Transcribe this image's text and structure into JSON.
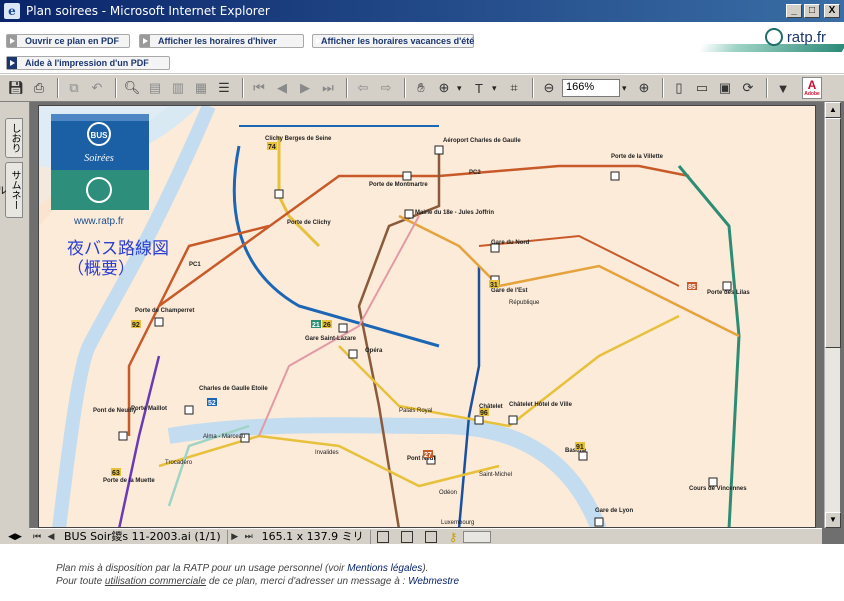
{
  "window": {
    "title": "Plan soirees - Microsoft Internet Explorer",
    "controls": [
      "_",
      "□",
      "X"
    ]
  },
  "header": {
    "buttons": [
      "Ouvrir ce plan en PDF",
      "Afficher les horaires d'hiver",
      "Afficher les horaires vacances d'été"
    ],
    "pdf_aid": "Aide à l'impression d'un PDF",
    "brand": "ratp.fr"
  },
  "toolbar": {
    "zoom": "166%",
    "adobe_label": "Adobe"
  },
  "side_tabs": [
    "しおり",
    "サムネール"
  ],
  "map": {
    "logo_bus": "BUS",
    "logo_soirees": "Soirées",
    "logo_url": "www.ratp.fr",
    "overlay_title_1": "夜バス路線図",
    "overlay_title_2": "（概要）",
    "station_labels": [
      "Clichy Berges de Seine",
      "Aéroport Charles de Gaulle",
      "Porte de Montmartre",
      "Mairie du 18e - Jules Joffrin",
      "Porte de la Villette",
      "Porte de Clichy",
      "Gare du Nord",
      "Gare de l'Est",
      "Porte de Champerret",
      "Gare Saint-Lazare",
      "Opéra",
      "Charles de Gaulle Etoile",
      "Porte des Lilas",
      "Châtelet",
      "Châtelet Hôtel de Ville",
      "Pont Neuf",
      "Bastille",
      "Gare de Lyon",
      "Cours de Vincennes",
      "Porte Maillot",
      "Pont de Neuilly",
      "Porte de la Muette",
      "Palais Royal",
      "Saint-Michel",
      "Odéon",
      "Luxembourg",
      "Trocadéro",
      "Alma - Marceau",
      "Invalides",
      "République"
    ],
    "line_badges": [
      "74",
      "21",
      "26",
      "31",
      "52",
      "92",
      "27",
      "91",
      "63",
      "96",
      "85",
      "PC2",
      "PC1"
    ]
  },
  "statusbar": {
    "document": "BUS Soir鑁s 11-2003.ai",
    "page": "(1/1)",
    "size": "165.1 x 137.9 ミリ"
  },
  "footer": {
    "line1_prefix": "Plan mis à disposition par la RATP pour un usage personnel (voir ",
    "line1_link": "Mentions légales",
    "line1_suffix": ").",
    "line2_prefix": "Pour toute ",
    "line2_link": "utilisation commerciale",
    "line2_mid": " de ce plan, merci d'adresser un message à : ",
    "line2_link2": "Webmestre"
  }
}
